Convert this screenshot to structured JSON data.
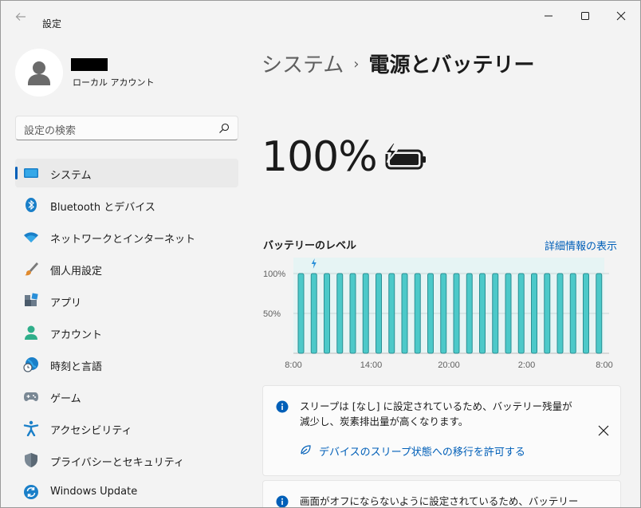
{
  "window": {
    "app_title": "設定",
    "back_icon": "arrow-left-icon",
    "controls": [
      "minimize-icon",
      "maximize-icon",
      "close-icon"
    ]
  },
  "profile": {
    "account_type": "ローカル アカウント"
  },
  "search": {
    "placeholder": "設定の検索"
  },
  "sidebar": {
    "items": [
      {
        "label": "システム",
        "icon": "monitor-icon",
        "active": true
      },
      {
        "label": "Bluetooth とデバイス",
        "icon": "bluetooth-icon"
      },
      {
        "label": "ネットワークとインターネット",
        "icon": "wifi-icon"
      },
      {
        "label": "個人用設定",
        "icon": "paintbrush-icon"
      },
      {
        "label": "アプリ",
        "icon": "apps-icon"
      },
      {
        "label": "アカウント",
        "icon": "person-icon"
      },
      {
        "label": "時刻と言語",
        "icon": "globe-clock-icon"
      },
      {
        "label": "ゲーム",
        "icon": "gamepad-icon"
      },
      {
        "label": "アクセシビリティ",
        "icon": "accessibility-icon"
      },
      {
        "label": "プライバシーとセキュリティ",
        "icon": "shield-icon"
      },
      {
        "label": "Windows Update",
        "icon": "sync-icon"
      }
    ]
  },
  "main": {
    "breadcrumb_parent": "システム",
    "breadcrumb_separator": "›",
    "breadcrumb_current": "電源とバッテリー",
    "battery_percent": "100%",
    "battery_level_title": "バッテリーのレベル",
    "details_link": "詳細情報の表示",
    "cards": [
      {
        "text": "スリープは [なし] に設定されているため、バッテリー残量が減少し、炭素排出量が高くなります。",
        "link": "デバイスのスリープ状態への移行を許可する"
      },
      {
        "text": "画面がオフにならないように設定されているため、バッテリーの寿"
      }
    ]
  },
  "colors": {
    "accent": "#005fb8",
    "bar_fill": "#4cc9c9",
    "bar_stroke": "#2a8f93",
    "chart_bg": "#e6f4f4"
  },
  "chart_data": {
    "type": "bar",
    "title": "バッテリーのレベル",
    "x_tick_labels": [
      "8:00",
      "14:00",
      "20:00",
      "2:00",
      "8:00"
    ],
    "y_tick_labels": [
      "100%",
      "50%"
    ],
    "ylim": [
      0,
      100
    ],
    "values": [
      100,
      100,
      100,
      100,
      100,
      100,
      100,
      100,
      100,
      100,
      100,
      100,
      100,
      100,
      100,
      100,
      100,
      100,
      100,
      100,
      100,
      100,
      100,
      100
    ],
    "charging_marker_index": 1,
    "grid": true
  }
}
